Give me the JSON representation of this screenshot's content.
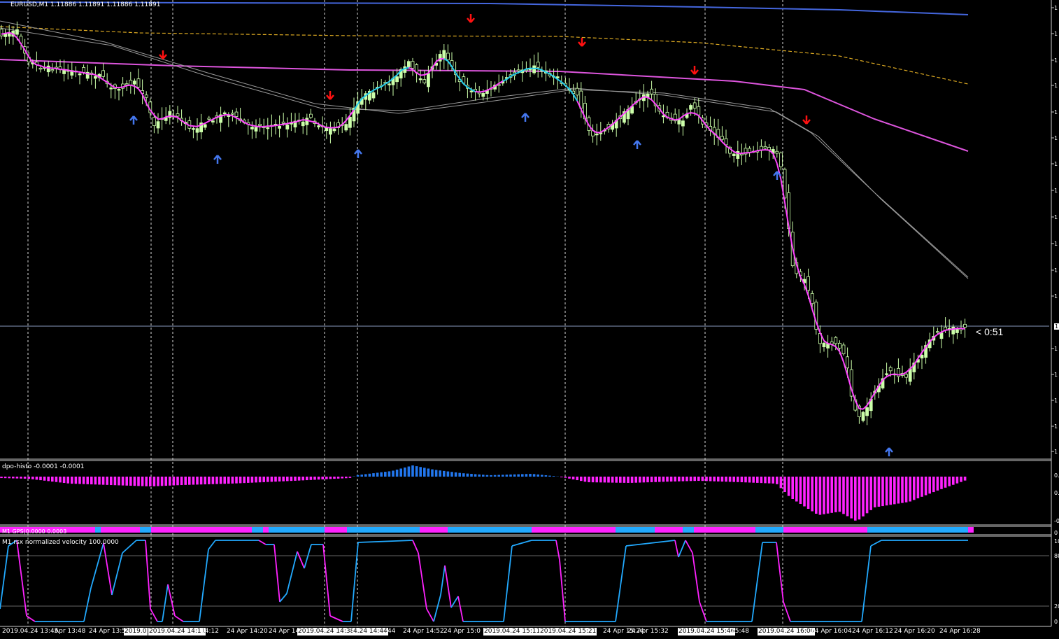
{
  "header": {
    "title": "EURUSD,M1  1.11886 1.11891 1.11886 1.11891"
  },
  "price_panel": {
    "timer": "< 0:51",
    "current_price_axis_label": "1",
    "axis_tick_label": "1"
  },
  "indicators": {
    "dpo": {
      "label": "dpo-histo -0.0001 -0.0001",
      "axis_top": "0.",
      "axis_mid": "0.",
      "axis_bottom": "-0"
    },
    "gps": {
      "label": "M1 GPS(0.0000 0.0003",
      "axis": "0"
    },
    "rsx": {
      "label": "M1 rsx normalized velocity 100.0000",
      "axis_top": "10",
      "axis_80": "80",
      "axis_20": "20",
      "axis_bottom": "0"
    }
  },
  "time_axis": [
    {
      "text": "2019.04.24 13:45",
      "highlight": false
    },
    {
      "text": "Apr 13:48",
      "highlight": false
    },
    {
      "text": "24 Apr 13:5",
      "highlight": false
    },
    {
      "text": "2019.0",
      "highlight": true
    },
    {
      "text": "2019.04.24 14:11",
      "highlight": true
    },
    {
      "text": "14:12",
      "highlight": false
    },
    {
      "text": "24 Apr 14:20",
      "highlight": false
    },
    {
      "text": "24 Apr 14:2",
      "highlight": false
    },
    {
      "text": "2019.04.24 14:38",
      "highlight": true
    },
    {
      "text": "4.24 14:44",
      "highlight": true
    },
    {
      "text": ":44",
      "highlight": false
    },
    {
      "text": "24 Apr 14:52",
      "highlight": false
    },
    {
      "text": "24 Apr 15:0",
      "highlight": false
    },
    {
      "text": "2019.04.24 15:11",
      "highlight": true
    },
    {
      "text": "2019.04.24 15:21",
      "highlight": true
    },
    {
      "text": "24 Apr 15:24",
      "highlight": false
    },
    {
      "text": "24 Apr 15:32",
      "highlight": false
    },
    {
      "text": "2019.04.24 15:46",
      "highlight": true
    },
    {
      "text": "15:48",
      "highlight": false
    },
    {
      "text": "2019.04.24 16:00",
      "highlight": true
    },
    {
      "text": "24 Apr 16:04",
      "highlight": false
    },
    {
      "text": "24 Apr 16:12",
      "highlight": false
    },
    {
      "text": "24 Apr 16:20",
      "highlight": false
    },
    {
      "text": "24 Apr 16:28",
      "highlight": false
    }
  ],
  "colors": {
    "background": "#000000",
    "bull_candle": "#ccffaa",
    "bear_candle": "#ffffff",
    "fast_ma": "#ff44ff",
    "fast_ma_up": "#22ccee",
    "ma_magenta": "#dd55dd",
    "ma_blue": "#4466dd",
    "ma_gold": "#ddaa22",
    "ma_gray": "#999999",
    "arrow_up": "#4477ee",
    "arrow_down": "#ff1111",
    "histo_pos": "#2277ee",
    "histo_neg": "#ff22ff",
    "rsx_up": "#22aaff",
    "rsx_down": "#ff22ff"
  }
}
